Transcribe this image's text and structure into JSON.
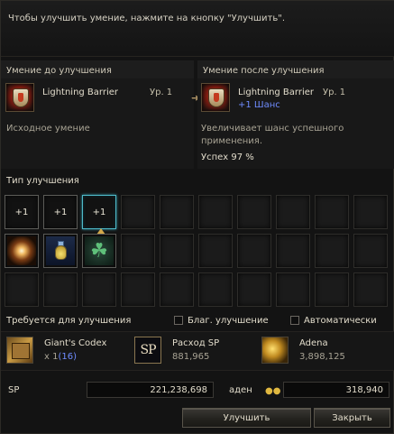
{
  "notice": "Чтобы улучшить умение, нажмите на кнопку \"Улучшить\".",
  "before": {
    "header": "Умение до улучшения",
    "skill_name": "Lightning Barrier",
    "level": "Ур. 1",
    "note": "Исходное умение"
  },
  "after": {
    "header": "Умение после улучшения",
    "skill_name": "Lightning Barrier",
    "level": "Ур. 1",
    "enchant": "+1 Шанс",
    "desc_line1": "Увеличивает шанс успешного",
    "desc_line2": "применения.",
    "success": "Успех 97 %"
  },
  "types": {
    "header": "Тип улучшения",
    "plus_labels": [
      "+1",
      "+1",
      "+1"
    ],
    "selected_index": 2,
    "row2_icons": [
      "sparkle-icon",
      "potion-icon",
      "clover-icon"
    ]
  },
  "requirements": {
    "header": "Требуется для улучшения",
    "blessed_label": "Благ. улучшение",
    "auto_label": "Автоматически",
    "items": [
      {
        "name": "Giant's Codex",
        "qty_prefix": "x 1",
        "qty_have": "(16)",
        "icon": "book-icon"
      },
      {
        "name": "Расход SP",
        "qty": "881,965",
        "icon": "sp-icon",
        "icon_text": "SP"
      },
      {
        "name": "Adena",
        "qty": "3,898,125",
        "icon": "adena-icon"
      }
    ]
  },
  "balance": {
    "sp_label": "SP",
    "sp_value": "221,238,698",
    "adena_label": "аден",
    "adena_value": "318,940"
  },
  "buttons": {
    "enchant": "Улучшить",
    "close": "Закрыть"
  }
}
